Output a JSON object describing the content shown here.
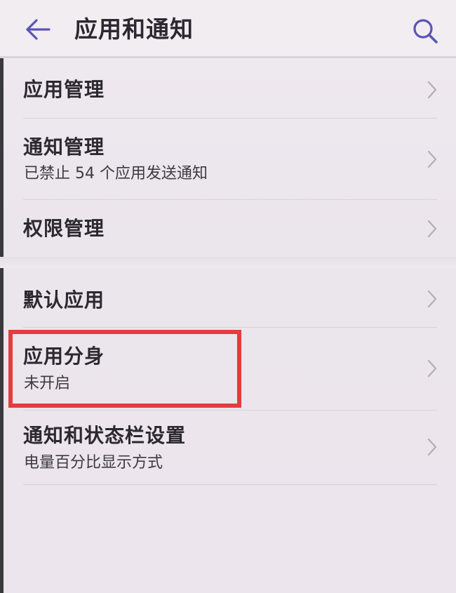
{
  "header": {
    "title": "应用和通知",
    "back_icon": "back-arrow-icon",
    "search_icon": "search-icon"
  },
  "items": [
    {
      "title": "应用管理",
      "subtitle": ""
    },
    {
      "title": "通知管理",
      "subtitle": "已禁止 54 个应用发送通知"
    },
    {
      "title": "权限管理",
      "subtitle": ""
    },
    {
      "title": "默认应用",
      "subtitle": ""
    },
    {
      "title": "应用分身",
      "subtitle": "未开启"
    },
    {
      "title": "通知和状态栏设置",
      "subtitle": "电量百分比显示方式"
    }
  ],
  "colors": {
    "accent": "#5a55b5",
    "highlight": "#e53b3f",
    "background": "#ece6ed"
  }
}
